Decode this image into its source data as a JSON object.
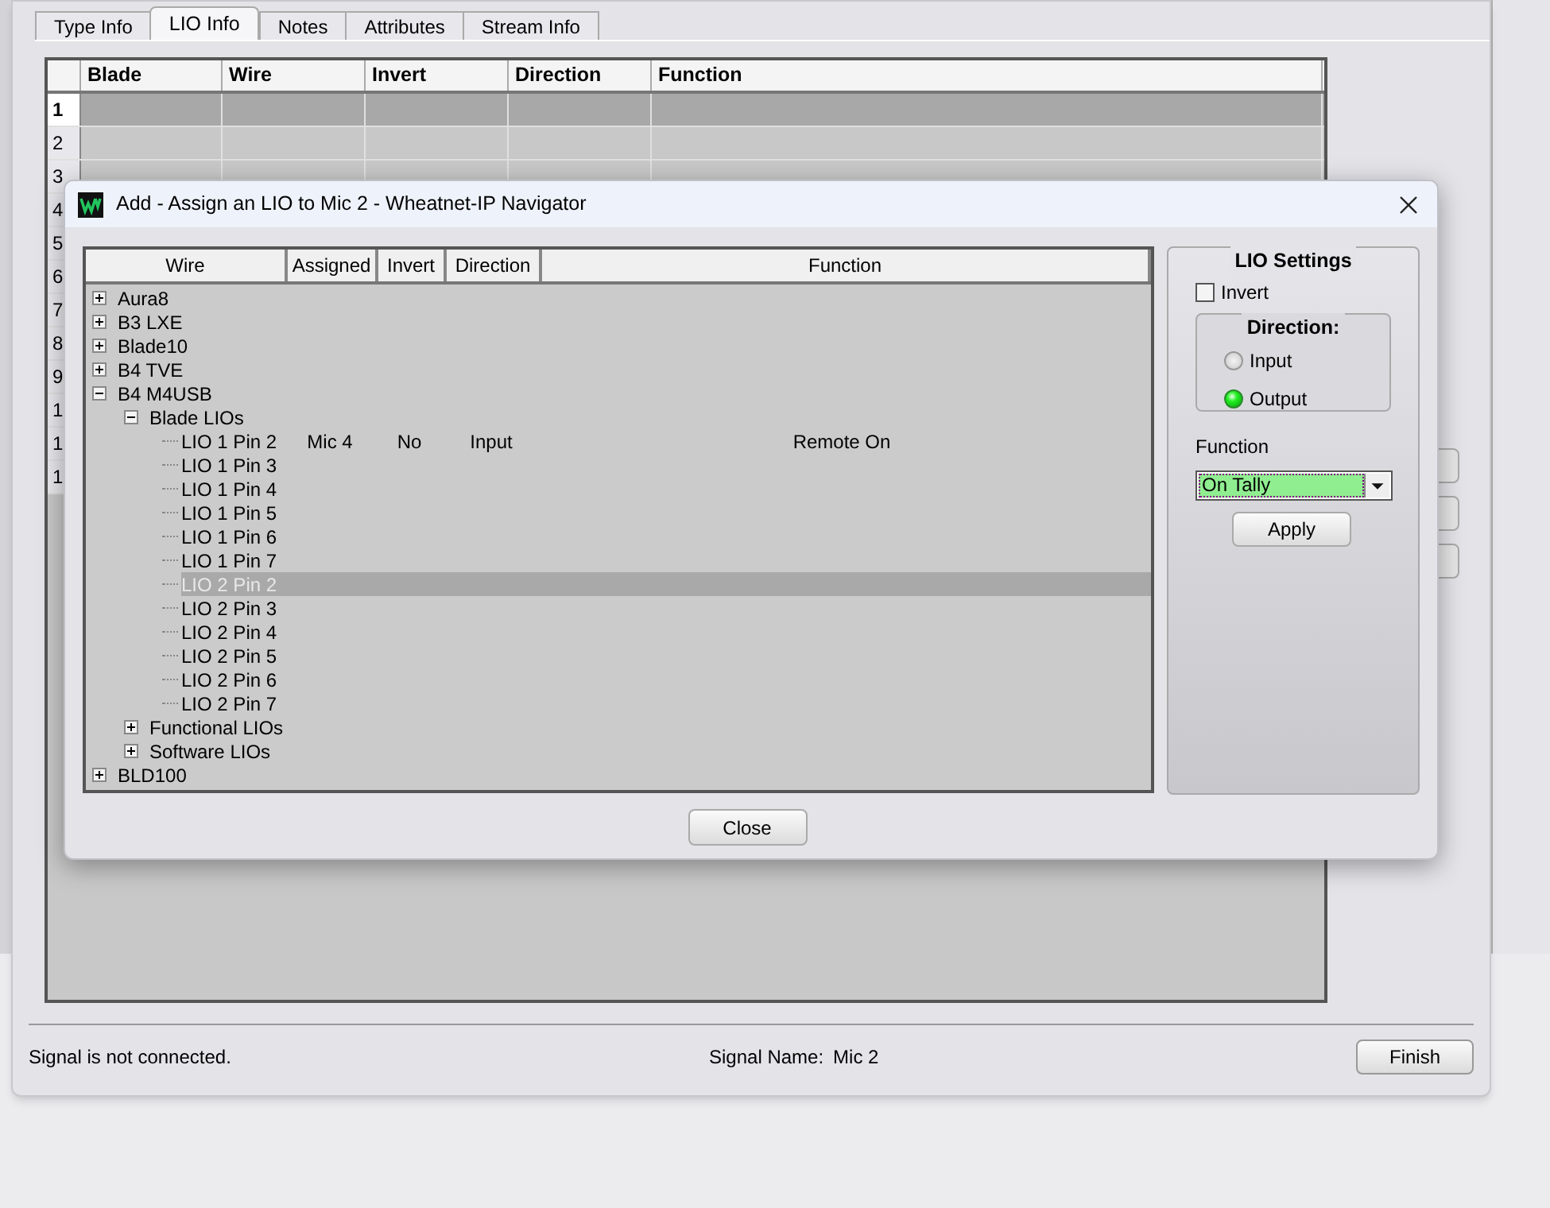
{
  "window": {
    "tabs": [
      {
        "label": "Type Info",
        "selected": false
      },
      {
        "label": "LIO Info",
        "selected": true
      },
      {
        "label": "Notes",
        "selected": false
      },
      {
        "label": "Attributes",
        "selected": false
      },
      {
        "label": "Stream Info",
        "selected": false
      }
    ],
    "grid": {
      "columns": [
        "Blade",
        "Wire",
        "Invert",
        "Direction",
        "Function"
      ],
      "rows": [
        {
          "number": "1",
          "selected": true
        },
        {
          "number": "2",
          "selected": false
        },
        {
          "number": "3",
          "selected": false
        },
        {
          "number": "4",
          "selected": false
        },
        {
          "number": "5",
          "selected": false
        },
        {
          "number": "6",
          "selected": false
        },
        {
          "number": "7",
          "selected": false
        },
        {
          "number": "8",
          "selected": false
        },
        {
          "number": "9",
          "selected": false
        },
        {
          "number": "1",
          "selected": false
        },
        {
          "number": "1",
          "selected": false
        },
        {
          "number": "1",
          "selected": false
        }
      ]
    },
    "status": "Signal is not connected.",
    "signal_name_label": "Signal Name:",
    "signal_name": "Mic 2",
    "finish_button": "Finish"
  },
  "dialog": {
    "title": "Add - Assign an LIO to Mic 2 - Wheatnet-IP Navigator",
    "tree": {
      "columns": [
        "Wire",
        "Assigned",
        "Invert",
        "Direction",
        "Function"
      ],
      "items": [
        {
          "wire": "Aura8",
          "expanded": false,
          "selected": false
        },
        {
          "wire": "B3 LXE",
          "expanded": false,
          "selected": false
        },
        {
          "wire": "Blade10",
          "expanded": false,
          "selected": false
        },
        {
          "wire": "B4 TVE",
          "expanded": false,
          "selected": false
        },
        {
          "wire": "B4 M4USB",
          "expanded": true,
          "selected": false,
          "children": [
            {
              "wire": "Blade LIOs",
              "expanded": true,
              "selected": false,
              "children": [
                {
                  "wire": "LIO 1 Pin 2",
                  "assigned": "Mic 4",
                  "invert": "No",
                  "direction": "Input",
                  "function": "Remote On",
                  "selected": false
                },
                {
                  "wire": "LIO 1 Pin 3",
                  "selected": false
                },
                {
                  "wire": "LIO 1 Pin 4",
                  "selected": false
                },
                {
                  "wire": "LIO 1 Pin 5",
                  "selected": false
                },
                {
                  "wire": "LIO 1 Pin 6",
                  "selected": false
                },
                {
                  "wire": "LIO 1 Pin 7",
                  "selected": false
                },
                {
                  "wire": "LIO 2 Pin 2",
                  "selected": true
                },
                {
                  "wire": "LIO 2 Pin 3",
                  "selected": false
                },
                {
                  "wire": "LIO 2 Pin 4",
                  "selected": false
                },
                {
                  "wire": "LIO 2 Pin 5",
                  "selected": false
                },
                {
                  "wire": "LIO 2 Pin 6",
                  "selected": false
                },
                {
                  "wire": "LIO 2 Pin 7",
                  "selected": false
                }
              ]
            },
            {
              "wire": "Functional LIOs",
              "expanded": false,
              "selected": false
            },
            {
              "wire": "Software LIOs",
              "expanded": false,
              "selected": false
            }
          ]
        },
        {
          "wire": "BLD100",
          "expanded": false,
          "selected": false
        }
      ]
    },
    "lio_settings": {
      "title": "LIO Settings",
      "invert": {
        "label": "Invert",
        "checked": false
      },
      "direction": {
        "title": "Direction:",
        "options": [
          {
            "label": "Input",
            "selected": false
          },
          {
            "label": "Output",
            "selected": true
          }
        ]
      },
      "function_label": "Function",
      "function_value": "On Tally",
      "apply_button": "Apply"
    },
    "close_button": "Close"
  }
}
